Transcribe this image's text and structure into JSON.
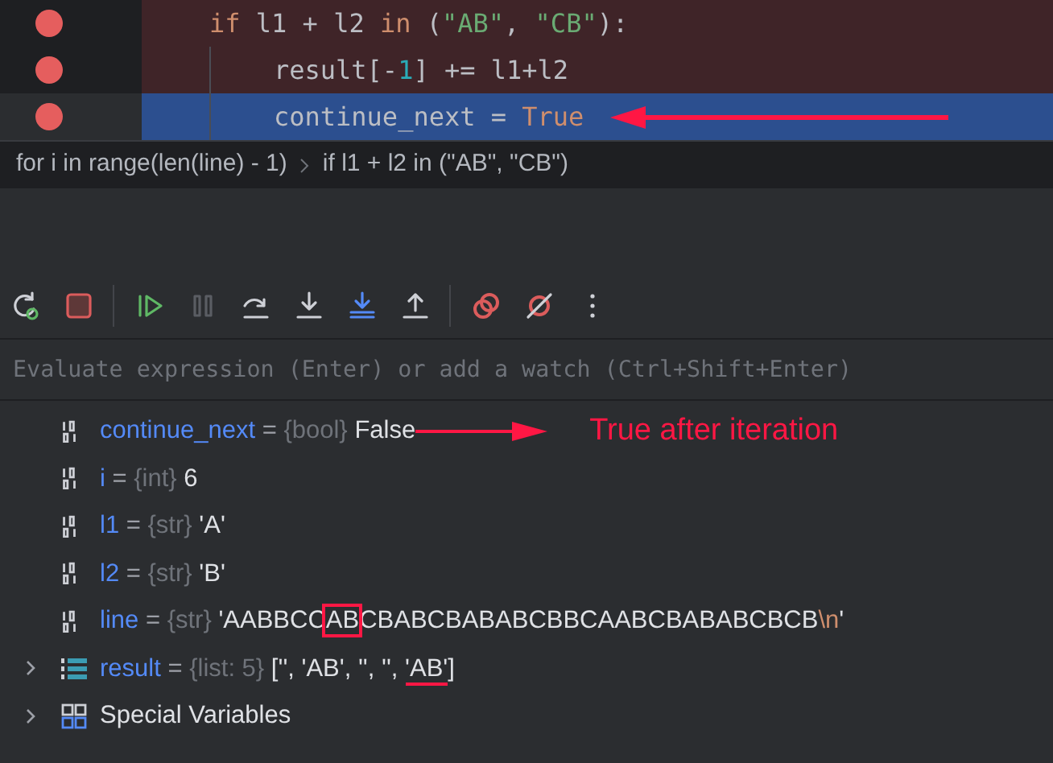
{
  "editor": {
    "lines": [
      {
        "breakpoint": true,
        "current": false,
        "arrow": false,
        "tokens": [
          {
            "kind": "keyword",
            "text": "if"
          },
          {
            "kind": "plain",
            "text": " l1 + l2 "
          },
          {
            "kind": "keyword",
            "text": "in"
          },
          {
            "kind": "plain",
            "text": " ("
          },
          {
            "kind": "string",
            "text": "\"AB\""
          },
          {
            "kind": "plain",
            "text": ", "
          },
          {
            "kind": "string",
            "text": "\"CB\""
          },
          {
            "kind": "plain",
            "text": "):"
          }
        ],
        "children": [
          {
            "breakpoint": true,
            "current": false,
            "arrow": false,
            "tokens": [
              {
                "kind": "plain",
                "text": "result[-"
              },
              {
                "kind": "number",
                "text": "1"
              },
              {
                "kind": "plain",
                "text": "] += l1+l2"
              }
            ]
          },
          {
            "breakpoint": true,
            "current": true,
            "arrow": true,
            "tokens": [
              {
                "kind": "plain",
                "text": "continue_next = "
              },
              {
                "kind": "keyword",
                "text": "True"
              }
            ]
          }
        ]
      }
    ]
  },
  "breadcrumbs": [
    "for i in range(len(line) - 1)",
    "if l1 + l2 in (\"AB\", \"CB\")"
  ],
  "toolbar": [
    {
      "kind": "rerun",
      "disabled": false
    },
    {
      "kind": "stop",
      "disabled": false
    },
    {
      "kind": "separator"
    },
    {
      "kind": "resume",
      "disabled": false
    },
    {
      "kind": "pause",
      "disabled": true
    },
    {
      "kind": "step-over",
      "disabled": false
    },
    {
      "kind": "step-into",
      "disabled": false
    },
    {
      "kind": "step-into-my-code",
      "disabled": false
    },
    {
      "kind": "step-out",
      "disabled": false
    },
    {
      "kind": "separator"
    },
    {
      "kind": "breakpoints",
      "disabled": false
    },
    {
      "kind": "mute",
      "disabled": false
    },
    {
      "kind": "more",
      "disabled": false
    }
  ],
  "evaluate": {
    "placeholder": "Evaluate expression (Enter) or add a watch (Ctrl+Shift+Enter)"
  },
  "variables": [
    {
      "kind": "primitive",
      "name": "continue_next",
      "operator": "=",
      "type": "{bool}",
      "value": [
        {
          "kind": "plain",
          "text": "False"
        }
      ],
      "expandable": false,
      "note": "True after iteration"
    },
    {
      "kind": "primitive",
      "name": "i",
      "operator": "=",
      "type": "{int}",
      "value": [
        {
          "kind": "plain",
          "text": "6"
        }
      ],
      "expandable": false
    },
    {
      "kind": "primitive",
      "name": "l1",
      "operator": "=",
      "type": "{str}",
      "value": [
        {
          "kind": "plain",
          "text": "'A'"
        }
      ],
      "expandable": false
    },
    {
      "kind": "primitive",
      "name": "l2",
      "operator": "=",
      "type": "{str}",
      "value": [
        {
          "kind": "plain",
          "text": "'B'"
        }
      ],
      "expandable": false
    },
    {
      "kind": "primitive",
      "name": "line",
      "operator": "=",
      "type": "{str}",
      "value": [
        {
          "kind": "plain",
          "text": "'AABBCC"
        },
        {
          "kind": "boxed",
          "text": "AB"
        },
        {
          "kind": "plain",
          "text": "CBABCBABABCBBCAABCBABABCBCB"
        },
        {
          "kind": "escape",
          "text": "\\n"
        },
        {
          "kind": "plain",
          "text": "'"
        }
      ],
      "expandable": false
    },
    {
      "kind": "list",
      "name": "result",
      "operator": "=",
      "type": "{list: 5}",
      "value": [
        {
          "kind": "plain",
          "text": "['', 'AB', '', '', "
        },
        {
          "kind": "underlined",
          "text": "'AB'"
        },
        {
          "kind": "plain",
          "text": "]"
        }
      ],
      "expandable": true
    },
    {
      "kind": "group",
      "name": "Special Variables",
      "expandable": true
    }
  ]
}
